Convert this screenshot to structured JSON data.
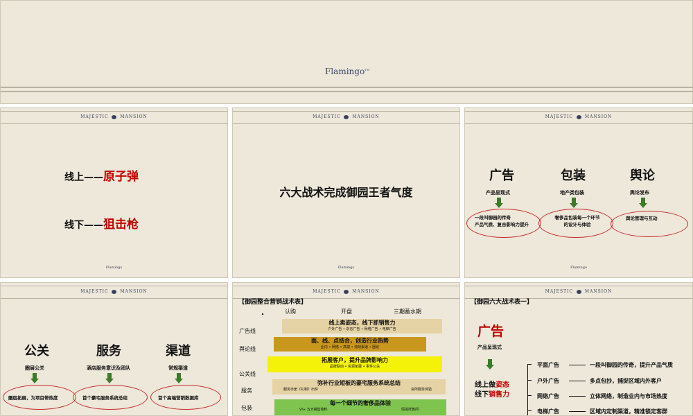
{
  "s0": {
    "logo": "Flamingo",
    "logo_sup": "TM"
  },
  "hdr": {
    "left": "MAJESTIC",
    "right": "MANSION"
  },
  "foot": "Flamingo",
  "s1": {
    "line1_prefix": "线上——",
    "line1_hl": "原子弹",
    "line2_prefix": "线下——",
    "line2_hl": "狙击枪"
  },
  "s2": {
    "title": "六大战术完成御园王者气度"
  },
  "s3": {
    "cols": [
      {
        "title": "广告",
        "sub": "产品呈现式",
        "desc": "一段叫御园的传奇\n产品气质、复合影响力提升"
      },
      {
        "title": "包装",
        "sub": "地产类包装",
        "desc": "奢侈品包装每一个环节\n的设计与体验"
      },
      {
        "title": "舆论",
        "sub": "舆论发布",
        "desc": "舆论管理与互动"
      }
    ]
  },
  "s4": {
    "cols": [
      {
        "title": "公关",
        "sub": "圈层公关",
        "desc": "圈层拓展，为项目带热度"
      },
      {
        "title": "服务",
        "sub": "酒店服务意识及团队",
        "desc": "首个豪宅服务系统总结"
      },
      {
        "title": "渠道",
        "sub": "常规渠道",
        "desc": "首个高端营销数据库"
      }
    ]
  },
  "s5": {
    "title": "【御园整合营销战术表】",
    "phases": [
      "认购",
      "开盘",
      "三期蓄水期"
    ],
    "rows": [
      "广告线",
      "舆论线",
      "公关线",
      "服务",
      "包装"
    ],
    "bars": [
      {
        "title": "线上卖姿态，线下抓销售力",
        "sub": "户外广告 • 杂志广告 • 网络广告 • 电梯广告",
        "color": "#e6d3a5"
      },
      {
        "title": "面、线、点结合，创造行业热势",
        "sub": "业内 • 网络 • 高端 • 流动渠道 • 圈论",
        "color": "#c9961e"
      },
      {
        "title": "拓展客户，提升品牌影响力",
        "sub": "品牌联动 • 资源拓展 • 事件公关",
        "color": "#f5f20a"
      },
      {
        "title": "弥补行业短板的豪宅服务系统总结",
        "sub_left": "服务手册《礼制》出炉",
        "sub_right": "会所服务体验",
        "color": "#e6d3a5"
      },
      {
        "title": "每一个细节的奢侈品体验",
        "sub_left": "VI+ 五大销售物料",
        "sub_right": "情境样板间",
        "color": "#7fc44f"
      }
    ]
  },
  "s6": {
    "title": "【御园六大战术表一】",
    "heading": "广告",
    "sub": "产品呈现式",
    "main1_prefix": "线上做",
    "main1_hl": "姿态",
    "main2_prefix": "线下",
    "main2_hl": "销售力",
    "items": [
      {
        "label": "平面广告",
        "desc": "一段叫御园的传奇，提升产品气质"
      },
      {
        "label": "户外广告",
        "desc": "多点包抄，捕捉区域内外客户"
      },
      {
        "label": "网络广告",
        "desc": "立体网络，制造业内与市场热度"
      },
      {
        "label": "电梯广告",
        "desc": "区域内定制渠道，精准锁定客群"
      }
    ]
  }
}
